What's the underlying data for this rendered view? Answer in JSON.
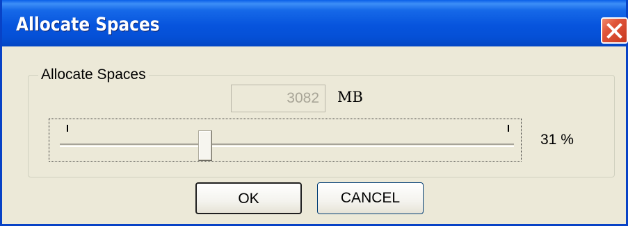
{
  "window": {
    "title": "Allocate Spaces",
    "close_icon": "close-icon"
  },
  "group": {
    "label": "Allocate Spaces"
  },
  "size": {
    "value": "3082",
    "unit": "MB"
  },
  "slider": {
    "percent_text": "31 %",
    "value_fraction": 0.31
  },
  "buttons": {
    "ok_label": "OK",
    "cancel_label": "CANCEL"
  },
  "colors": {
    "titlebar": "#0754dd",
    "close": "#e0553a",
    "face": "#ece9d8"
  }
}
